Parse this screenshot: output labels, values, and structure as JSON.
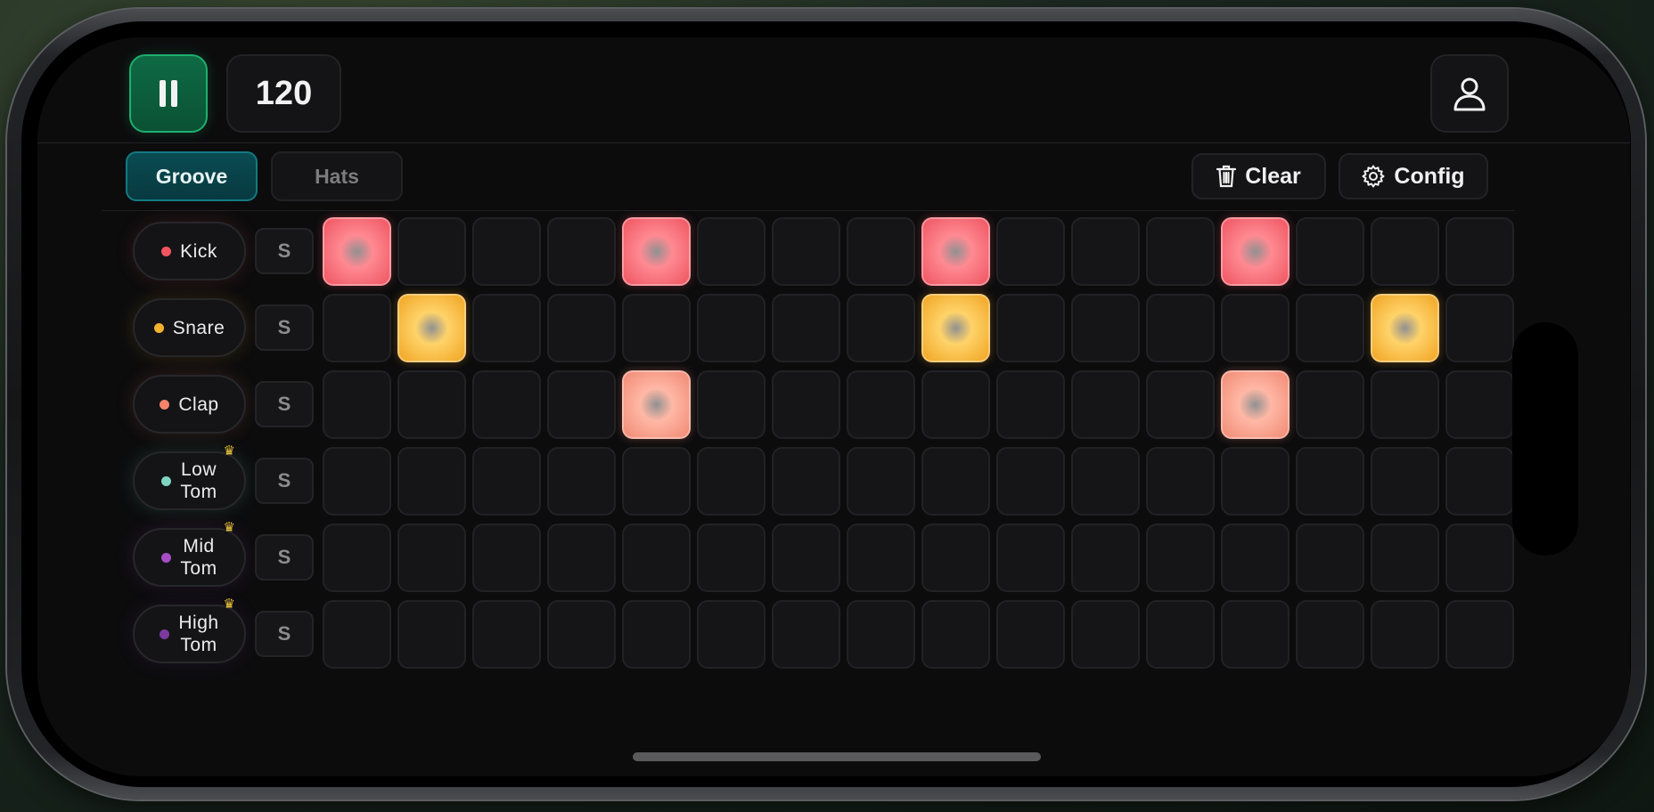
{
  "transport": {
    "state": "playing",
    "pause_label": "II",
    "bpm": "120"
  },
  "tabs": [
    {
      "label": "Groove",
      "active": true
    },
    {
      "label": "Hats",
      "active": false
    }
  ],
  "actions": {
    "clear_label": "Clear",
    "config_label": "Config"
  },
  "icons": {
    "pause": "pause-icon",
    "user": "user-icon",
    "trash": "trash-icon",
    "gear": "gear-icon",
    "crown": "crown-icon"
  },
  "tracks": [
    {
      "name": "Kick",
      "color": "#f2545f",
      "premium": false,
      "solo": "S",
      "steps": [
        1,
        0,
        0,
        0,
        1,
        0,
        0,
        0,
        1,
        0,
        0,
        0,
        1,
        0,
        0,
        0
      ]
    },
    {
      "name": "Snare",
      "color": "#f4b12c",
      "premium": false,
      "solo": "S",
      "steps": [
        0,
        1,
        0,
        0,
        0,
        0,
        0,
        0,
        1,
        0,
        0,
        0,
        0,
        0,
        1,
        0
      ]
    },
    {
      "name": "Clap",
      "color": "#f6836c",
      "premium": false,
      "solo": "S",
      "steps": [
        0,
        0,
        0,
        0,
        1,
        0,
        0,
        0,
        0,
        0,
        0,
        0,
        1,
        0,
        0,
        0
      ]
    },
    {
      "name": "Low\nTom",
      "color": "#7fd4c2",
      "premium": true,
      "solo": "S",
      "steps": [
        0,
        0,
        0,
        0,
        0,
        0,
        0,
        0,
        0,
        0,
        0,
        0,
        0,
        0,
        0,
        0
      ]
    },
    {
      "name": "Mid\nTom",
      "color": "#a64dc4",
      "premium": true,
      "solo": "S",
      "steps": [
        0,
        0,
        0,
        0,
        0,
        0,
        0,
        0,
        0,
        0,
        0,
        0,
        0,
        0,
        0,
        0
      ]
    },
    {
      "name": "High\nTom",
      "color": "#7c3aa0",
      "premium": true,
      "solo": "S",
      "steps": [
        0,
        0,
        0,
        0,
        0,
        0,
        0,
        0,
        0,
        0,
        0,
        0,
        0,
        0,
        0,
        0
      ]
    }
  ],
  "pad_colors": {
    "Kick": [
      "#ff8a92",
      "#ee5561"
    ],
    "Snare": [
      "#ffd36a",
      "#f0a523"
    ],
    "Clap": [
      "#ffb8a6",
      "#f08a74"
    ]
  }
}
